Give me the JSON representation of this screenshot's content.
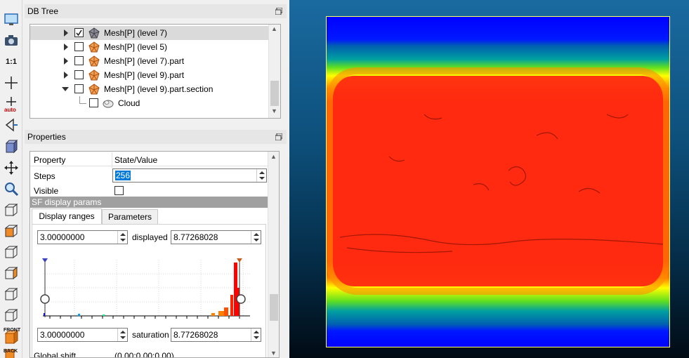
{
  "toolbar": {
    "items": [
      {
        "name": "screen-icon"
      },
      {
        "name": "camera-icon"
      },
      {
        "name": "one-to-one-icon",
        "label": "1:1"
      },
      {
        "name": "crosshair-icon"
      },
      {
        "name": "auto-pick-icon",
        "label": "auto"
      },
      {
        "name": "rotate-mode-icon"
      },
      {
        "name": "perspective-cube-icon"
      },
      {
        "name": "translate-icon"
      },
      {
        "name": "zoom-icon"
      },
      {
        "name": "view-cube-1-icon"
      },
      {
        "name": "view-cube-2-icon"
      },
      {
        "name": "view-cube-3-icon"
      },
      {
        "name": "view-cube-4-icon"
      },
      {
        "name": "view-cube-5-icon"
      },
      {
        "name": "view-cube-6-icon"
      },
      {
        "name": "front-view-icon",
        "label": "FRONT"
      },
      {
        "name": "back-view-icon",
        "label": "BACK"
      }
    ]
  },
  "dbtree": {
    "title": "DB Tree",
    "items": [
      {
        "label": "Mesh[P] (level 7)",
        "checked": true,
        "expanded": false,
        "selected": true
      },
      {
        "label": "Mesh[P] (level 5)",
        "checked": false,
        "expanded": false,
        "selected": false
      },
      {
        "label": "Mesh[P] (level 7).part",
        "checked": false,
        "expanded": false,
        "selected": false
      },
      {
        "label": "Mesh[P] (level 9).part",
        "checked": false,
        "expanded": false,
        "selected": false
      },
      {
        "label": "Mesh[P] (level 9).part.section",
        "checked": false,
        "expanded": true,
        "selected": false
      },
      {
        "label": "Cloud",
        "checked": false,
        "expanded": false,
        "selected": false
      }
    ]
  },
  "properties": {
    "title": "Properties",
    "header": {
      "property": "Property",
      "value": "State/Value"
    },
    "steps": {
      "label": "Steps",
      "value": "256"
    },
    "visible": {
      "label": "Visible",
      "checked": false
    },
    "sf_section": "SF display params",
    "tabs": [
      "Display ranges",
      "Parameters"
    ],
    "displayed": {
      "min": "3.00000000",
      "label": "displayed",
      "max": "8.77268028"
    },
    "saturation": {
      "min": "3.00000000",
      "label": "saturation",
      "max": "8.77268028"
    },
    "global_shift": {
      "label": "Global shift",
      "value": "(0.00;0.00;0.00)"
    }
  },
  "histogram": {
    "colors": [
      "#0000ff",
      "#00a0ff",
      "#00ff80",
      "#ffff00",
      "#ff8000",
      "#ff0000"
    ]
  },
  "viewport": {
    "colors": {
      "high": "#ff2a10",
      "mid": "#ffff00",
      "low": "#0018ff",
      "frame": "#ffff66"
    }
  }
}
